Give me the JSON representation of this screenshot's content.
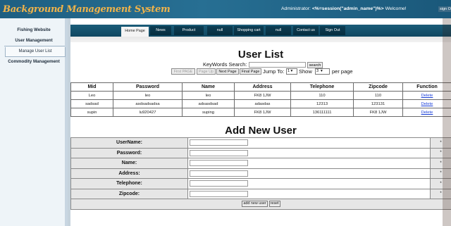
{
  "header": {
    "title": "Background Management System",
    "admin_text": "Administrator:",
    "session_text": "<%=session(\"admin_name\")%>",
    "welcome_text": "Welcome!",
    "signout_label": "sign O"
  },
  "sidebar": {
    "fishing": "Fishing Website",
    "user_management": "User Management",
    "manage_user_list": "Manage User List",
    "commodity_management": "Commodity Management"
  },
  "nav": {
    "home": "Home Page",
    "news": "News",
    "product": "Product",
    "null1": "null",
    "cart": "Shopping cart",
    "null2": "null",
    "contact": "Contact us",
    "signout": "Sign Out"
  },
  "user_list": {
    "title": "User List",
    "keywords_label": "KeyWords Search:",
    "search_value": "",
    "search_button": "search",
    "first_page": "First PAGE",
    "page_up": "Page Up",
    "next_page": "Next Page",
    "final_page": "Final Page",
    "jump_label": "Jump To:",
    "jump_value": "1",
    "show_label": "Show",
    "show_value": "3",
    "per_page_label": "per page",
    "columns": [
      "Mid",
      "Password",
      "Name",
      "Address",
      "Telephone",
      "Zipcode",
      "Function"
    ],
    "rows": [
      {
        "mid": "Leo",
        "password": "leo",
        "name": "leo",
        "address": "FK8 1JW",
        "telephone": "110",
        "zipcode": "110",
        "function": "Delete"
      },
      {
        "mid": "sadsad",
        "password": "asdsadsadsa",
        "name": "adsasdsad",
        "address": "adasdas",
        "telephone": "12313",
        "zipcode": "123131",
        "function": "Delete"
      },
      {
        "mid": "supin",
        "password": "lu920427",
        "name": "suping",
        "address": "FK8 1JW",
        "telephone": "136111111",
        "zipcode": "FK8 1JW",
        "function": "Delete"
      }
    ]
  },
  "add_user": {
    "title": "Add New User",
    "fields": [
      {
        "label": "UserName:",
        "value": "",
        "required": "*"
      },
      {
        "label": "Password:",
        "value": "",
        "required": "*"
      },
      {
        "label": "Name:",
        "value": "",
        "required": "*"
      },
      {
        "label": "Address:",
        "value": "",
        "required": "*"
      },
      {
        "label": "Telephone:",
        "value": "",
        "required": "*"
      },
      {
        "label": "Zipcode:",
        "value": "",
        "required": "*"
      }
    ],
    "add_button": "add new user",
    "reset_button": "reset"
  },
  "colors": {
    "header_bg": "#276f93",
    "brand_text": "#f0b34a",
    "nav_bg": "#0f4761",
    "link": "#1a3fd8",
    "outer_bg": "#3a2014"
  },
  "icons": {
    "select_arrow": "chevron-down-icon"
  }
}
